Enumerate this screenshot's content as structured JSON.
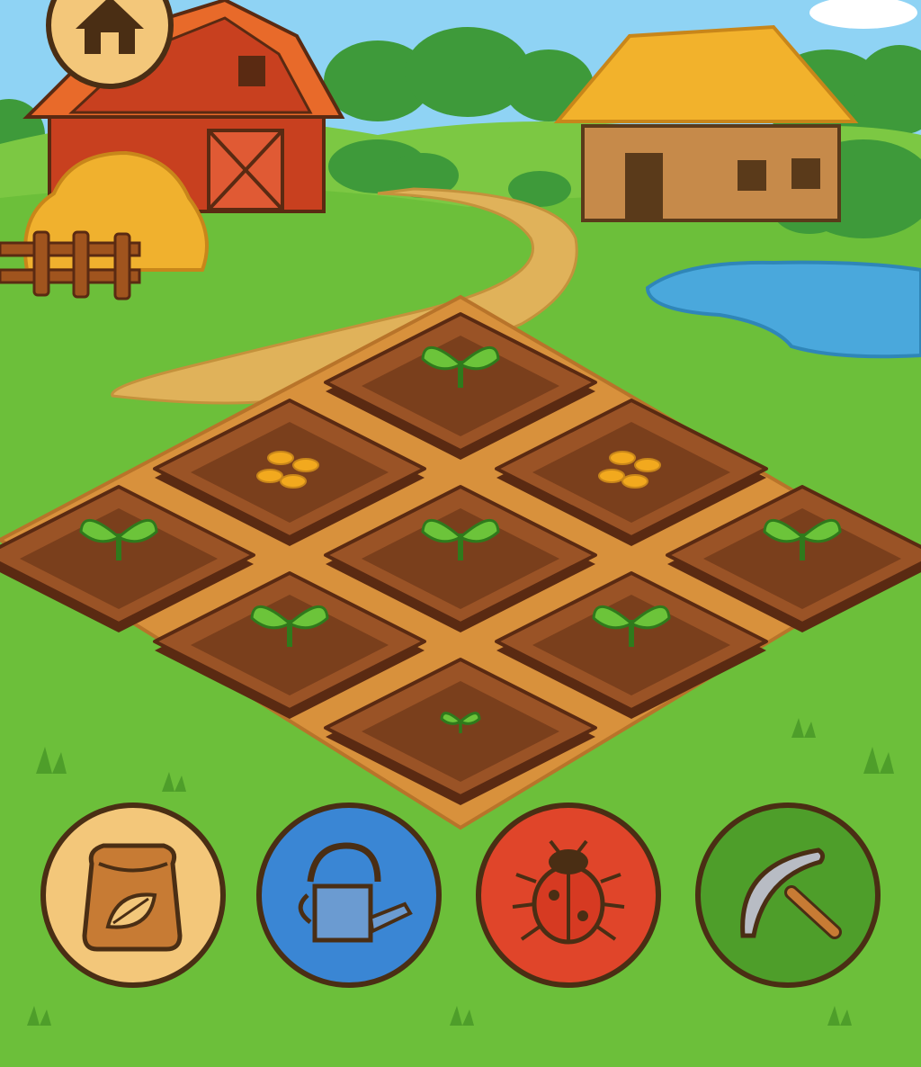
{
  "scene": "farm",
  "colors": {
    "sky": "#8fd3f4",
    "grass": "#6cbf3a",
    "grass_dark": "#4e9e2a",
    "soil": "#7a3f1c",
    "soil_light": "#9a5326",
    "path": "#e0b25a",
    "pond": "#4aa8dc",
    "outline": "#4a2e14"
  },
  "home_button": {
    "icon": "home-icon"
  },
  "plots": [
    {
      "row": 0,
      "col": 0,
      "state": "seedling"
    },
    {
      "row": 0,
      "col": 1,
      "state": "seeds"
    },
    {
      "row": 0,
      "col": 2,
      "state": "seedling"
    },
    {
      "row": 1,
      "col": 0,
      "state": "seeds"
    },
    {
      "row": 1,
      "col": 1,
      "state": "seedling"
    },
    {
      "row": 1,
      "col": 2,
      "state": "seedling"
    },
    {
      "row": 2,
      "col": 0,
      "state": "seedling"
    },
    {
      "row": 2,
      "col": 1,
      "state": "seedling"
    },
    {
      "row": 2,
      "col": 2,
      "state": "sprout"
    }
  ],
  "tools": [
    {
      "id": "seeds",
      "icon": "seed-bag-icon",
      "color": "#f3c77a"
    },
    {
      "id": "water",
      "icon": "watering-can-icon",
      "color": "#3a86d4"
    },
    {
      "id": "pest",
      "icon": "ladybug-icon",
      "color": "#e0452a"
    },
    {
      "id": "harvest",
      "icon": "pickaxe-icon",
      "color": "#4e9e2a"
    }
  ]
}
